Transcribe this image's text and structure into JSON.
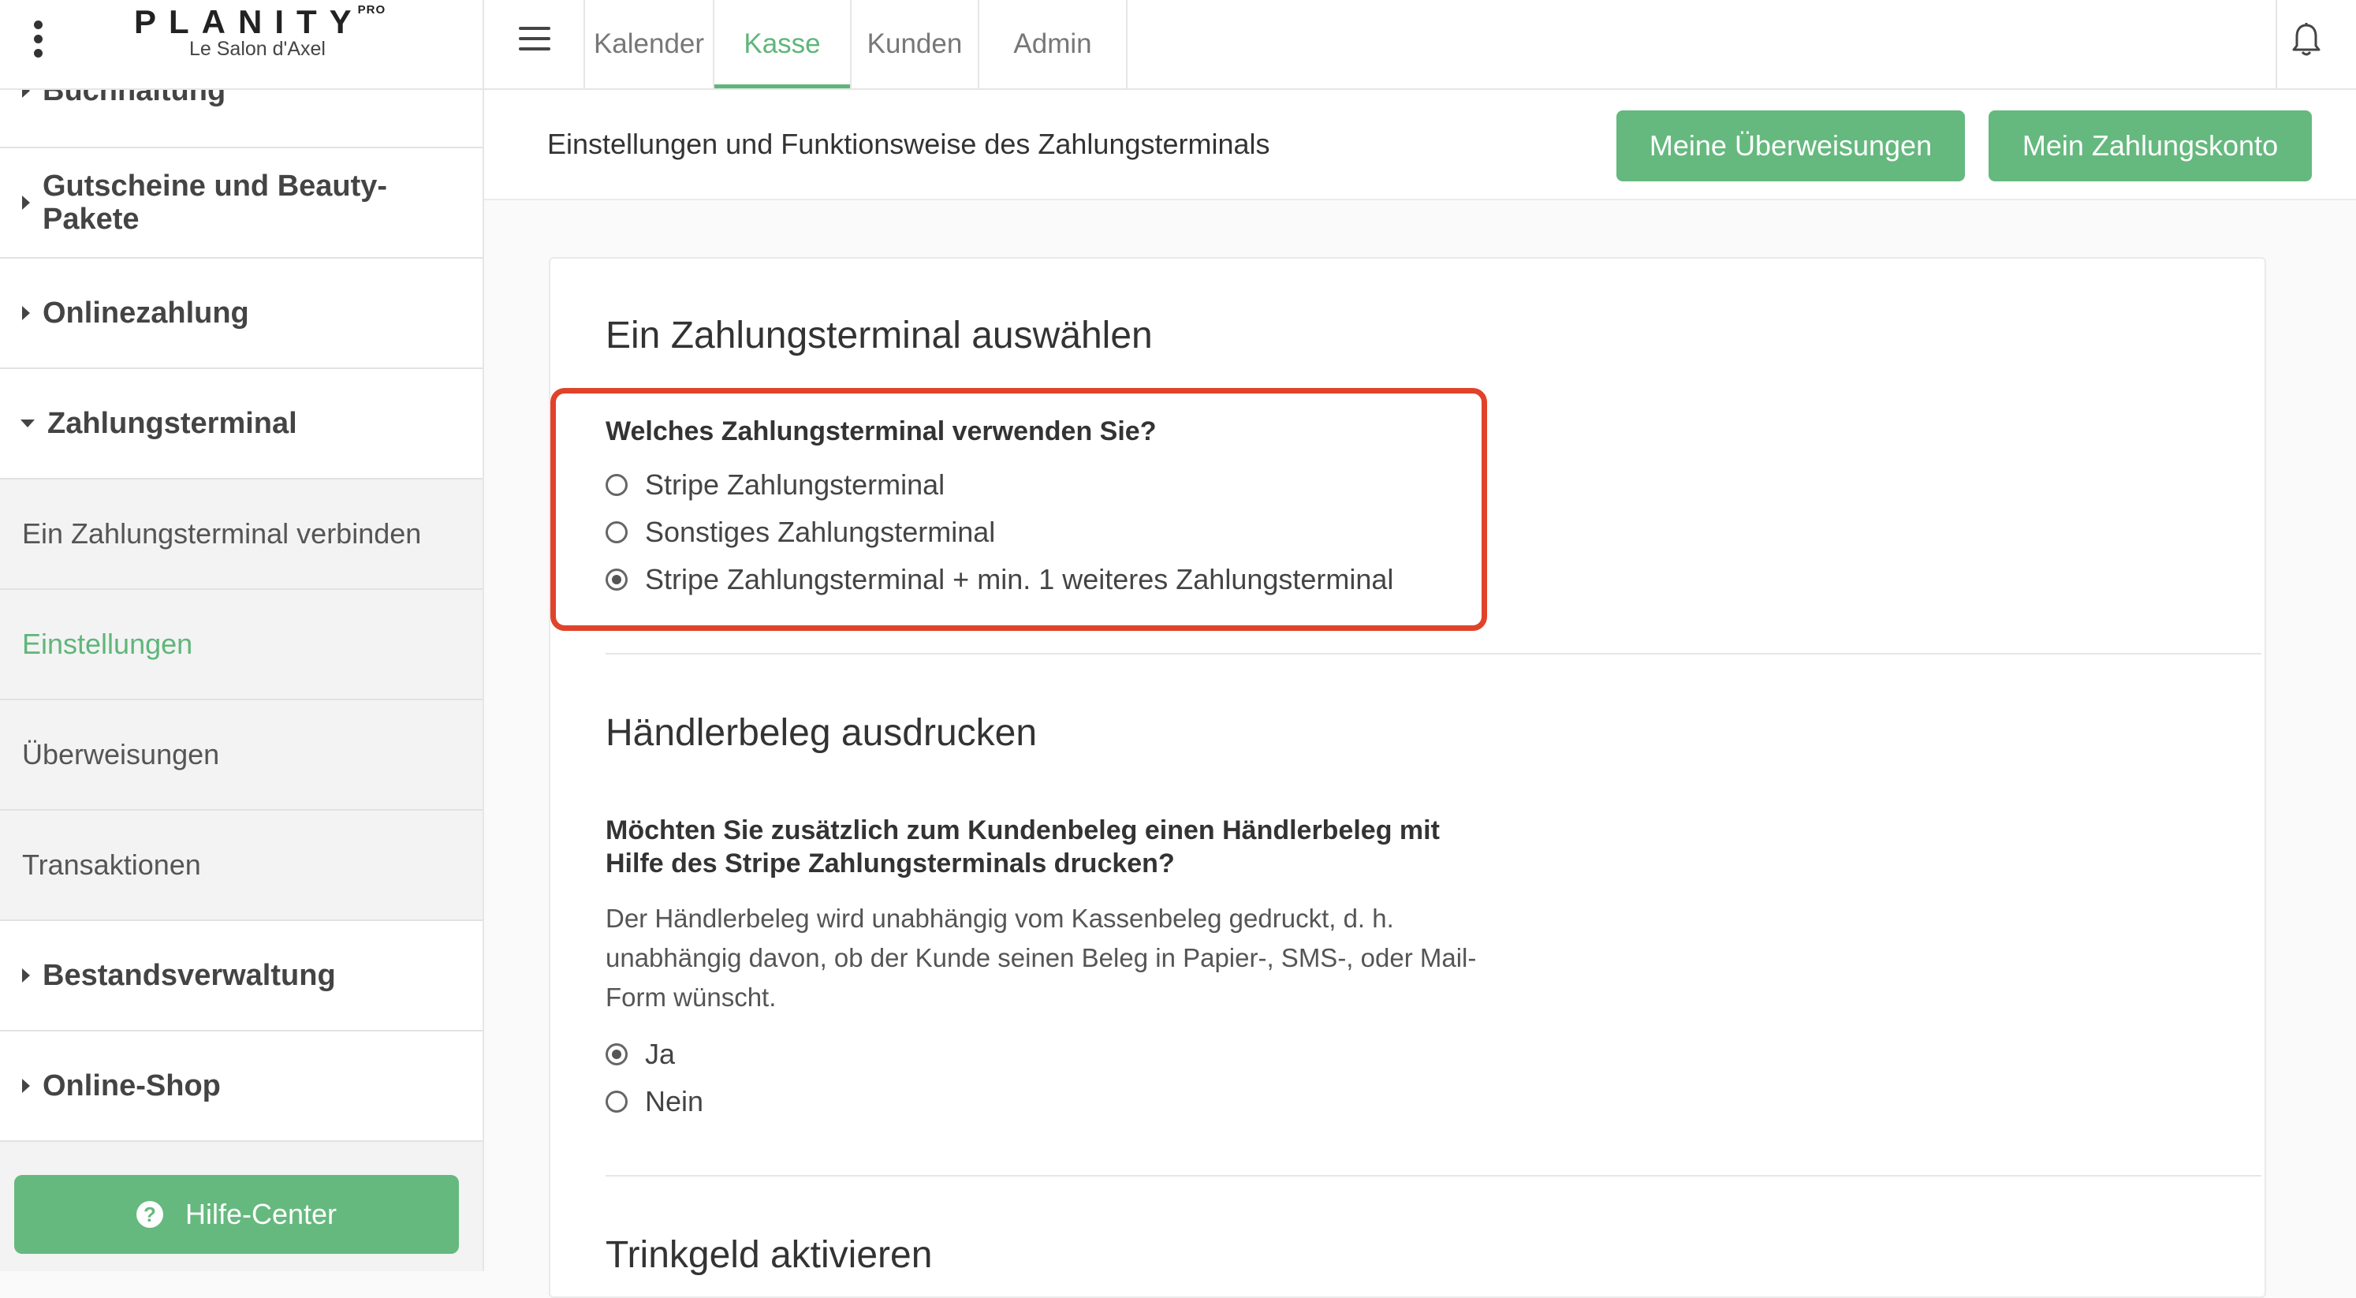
{
  "brand": {
    "logo": "PLANITY",
    "logo_suffix": "PRO",
    "salon": "Le Salon d'Axel"
  },
  "sidebar": {
    "items": [
      {
        "label": "Buchhaltung"
      },
      {
        "label": "Gutscheine und Beauty-Pakete"
      },
      {
        "label": "Onlinezahlung"
      },
      {
        "label": "Zahlungsterminal"
      },
      {
        "label": "Bestandsverwaltung"
      },
      {
        "label": "Online-Shop"
      }
    ],
    "subitems": [
      {
        "label": "Ein Zahlungsterminal verbinden"
      },
      {
        "label": "Einstellungen"
      },
      {
        "label": "Überweisungen"
      },
      {
        "label": "Transaktionen"
      }
    ],
    "help_button": "Hilfe-Center"
  },
  "nav": {
    "tabs": [
      "Kalender",
      "Kasse",
      "Kunden",
      "Admin"
    ],
    "active_tab": "Kasse"
  },
  "subheader": {
    "title": "Einstellungen und Funktionsweise des Zahlungsterminals",
    "btn_transfers": "Meine Überweisungen",
    "btn_account": "Mein Zahlungskonto"
  },
  "section_terminal": {
    "heading": "Ein Zahlungsterminal auswählen",
    "question": "Welches Zahlungsterminal verwenden Sie?",
    "options": [
      "Stripe Zahlungsterminal",
      "Sonstiges Zahlungsterminal",
      "Stripe Zahlungsterminal + min. 1 weiteres Zahlungsterminal"
    ],
    "selected_index": 2
  },
  "section_receipt": {
    "heading": "Händlerbeleg ausdrucken",
    "question_line1": "Möchten Sie zusätzlich zum Kundenbeleg einen Händlerbeleg mit",
    "question_line2": "Hilfe des Stripe Zahlungsterminals drucken?",
    "description_line1": "Der Händlerbeleg wird unabhängig vom Kassenbeleg gedruckt, d. h.",
    "description_line2": "unabhängig davon, ob der Kunde seinen Beleg in Papier-, SMS-, oder Mail-",
    "description_line3": "Form wünscht.",
    "options": [
      "Ja",
      "Nein"
    ],
    "selected_index": 0
  },
  "section_tip": {
    "heading": "Trinkgeld aktivieren"
  },
  "colors": {
    "accent": "#65b97e",
    "highlight": "#e0432a"
  }
}
